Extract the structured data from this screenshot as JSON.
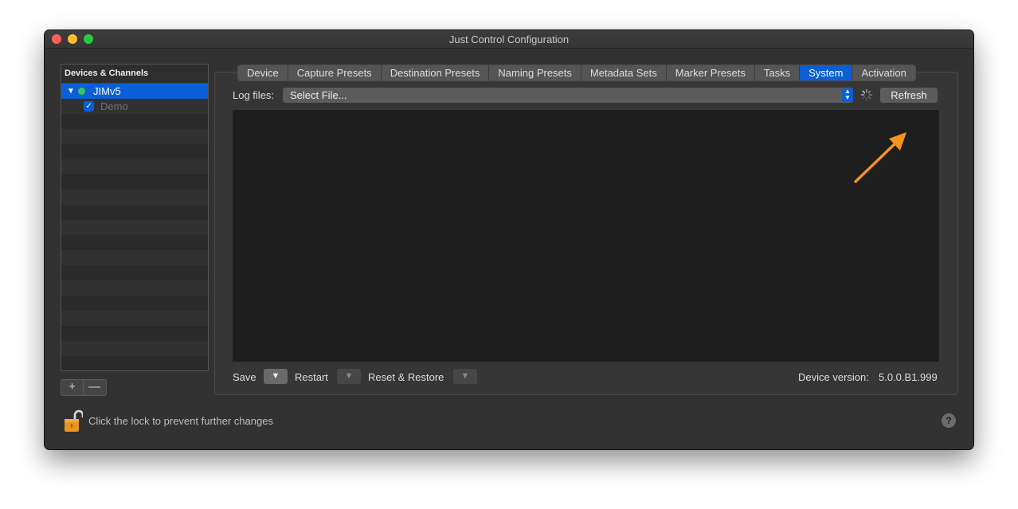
{
  "window": {
    "title": "Just Control Configuration"
  },
  "sidebar": {
    "header": "Devices & Channels",
    "items": [
      {
        "label": "JIMv5",
        "selected": true,
        "expanded": true,
        "status": "online"
      },
      {
        "label": "Demo",
        "checked": true,
        "indent": 1
      }
    ],
    "add_label": "+",
    "remove_label": "—"
  },
  "tabs": [
    {
      "label": "Device"
    },
    {
      "label": "Capture Presets"
    },
    {
      "label": "Destination Presets"
    },
    {
      "label": "Naming Presets"
    },
    {
      "label": "Metadata Sets"
    },
    {
      "label": "Marker Presets"
    },
    {
      "label": "Tasks"
    },
    {
      "label": "System",
      "active": true
    },
    {
      "label": "Activation"
    }
  ],
  "system": {
    "log_files_label": "Log files:",
    "file_select_value": "Select File...",
    "refresh_label": "Refresh",
    "save_label": "Save",
    "restart_label": "Restart",
    "reset_label": "Reset & Restore",
    "dropdown_glyph": "▼",
    "version_label": "Device version:",
    "version_value": "5.0.0.B1.999"
  },
  "footer": {
    "lock_text": "Click the lock to prevent further changes",
    "help_label": "?"
  },
  "icons": {
    "lock": "unlocked-padlock-icon",
    "spinner": "loading-spinner-icon",
    "annotation": "orange-arrow-icon"
  },
  "colors": {
    "accent": "#0a5fd6",
    "status_online": "#34c759",
    "annotation": "#f7931e",
    "window_bg": "#323232",
    "log_bg": "#1e1e1e"
  }
}
